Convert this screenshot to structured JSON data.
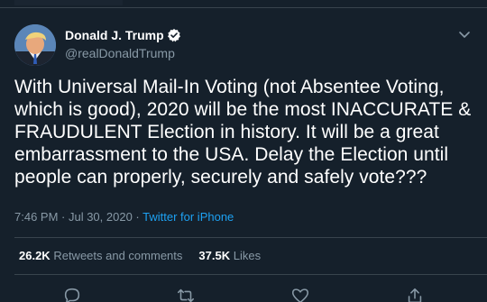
{
  "tweet": {
    "display_name": "Donald J. Trump",
    "handle": "@realDonaldTrump",
    "text": "With Universal Mail-In Voting (not Absentee Voting, which is good), 2020 will be the most INACCURATE & FRAUDULENT Election in history. It will be a great embarrassment to the USA. Delay the Election until people can properly, securely and safely vote???",
    "timestamp": "7:46 PM · Jul 30, 2020 · ",
    "source": "Twitter for iPhone"
  },
  "stats": {
    "retweets_count": "26.2K",
    "retweets_label": "Retweets and comments",
    "likes_count": "37.5K",
    "likes_label": "Likes"
  },
  "icons": {
    "avatar": "profile-photo",
    "verified": "verified-badge-icon",
    "caret": "chevron-down-icon",
    "reply": "reply-icon",
    "retweet": "retweet-icon",
    "like": "heart-icon",
    "share": "share-icon"
  },
  "colors": {
    "background": "#15202b",
    "text": "#ffffff",
    "secondary": "#8899a6",
    "accent": "#1da1f2",
    "divider": "#38444d"
  }
}
